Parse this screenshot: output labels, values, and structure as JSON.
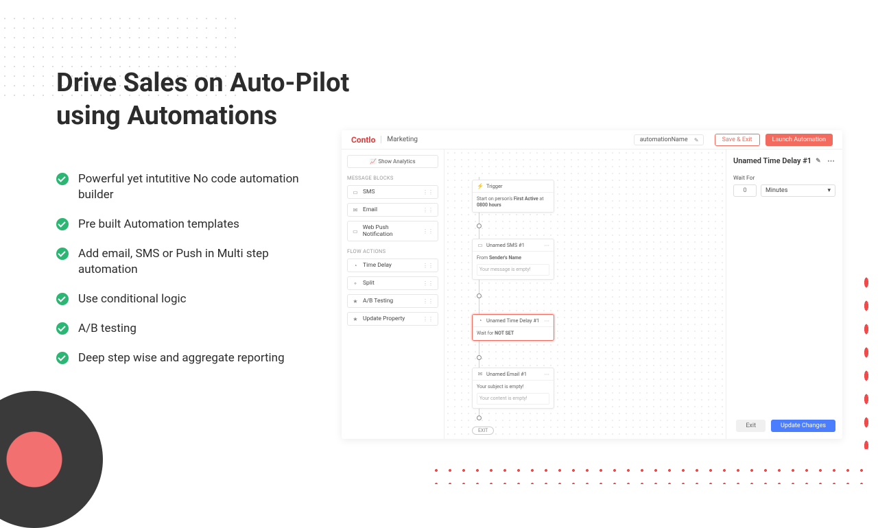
{
  "headline_line1": "Drive Sales on Auto-Pilot",
  "headline_line2": "using Automations",
  "bullets": [
    "Powerful yet intutitive No code automation builder",
    "Pre built Automation templates",
    "Add email, SMS or Push in Multi step automation",
    "Use conditional logic",
    "A/B testing",
    "Deep step wise and aggregate reporting"
  ],
  "app": {
    "brand": "Contlo",
    "section": "Marketing",
    "automation_name": "automationName",
    "save_exit": "Save & Exit",
    "launch": "Launch Automation",
    "show_analytics": "Show Analytics",
    "group_message_blocks": "MESSAGE BLOCKS",
    "group_flow_actions": "FLOW ACTIONS",
    "message_blocks": [
      "SMS",
      "Email",
      "Web Push Notification"
    ],
    "flow_actions": [
      "Time Delay",
      "Split",
      "A/B Testing",
      "Update Property"
    ],
    "trigger": {
      "label": "Trigger",
      "text_prefix": "Start on person's ",
      "text_bold": "First Active",
      "text_mid": " at ",
      "text_bold2": "0800 hours"
    },
    "sms_node": {
      "title": "Unamed SMS #1",
      "from_label": "From ",
      "from_value": "Sender's Name",
      "empty_msg": "Your message is empty!"
    },
    "delay_node": {
      "title": "Unamed Time Delay #1",
      "wait_prefix": "Wait for ",
      "wait_value": "NOT SET"
    },
    "email_node": {
      "title": "Unamed Email #1",
      "subject_empty": "Your subject is empty!",
      "content_empty": "Your content is empty!"
    },
    "exit": "EXIT",
    "right_panel": {
      "title": "Unamed Time Delay #1",
      "wait_for_label": "Wait For",
      "num_placeholder": "0",
      "unit": "Minutes",
      "exit_btn": "Exit",
      "update_btn": "Update Changes"
    }
  }
}
